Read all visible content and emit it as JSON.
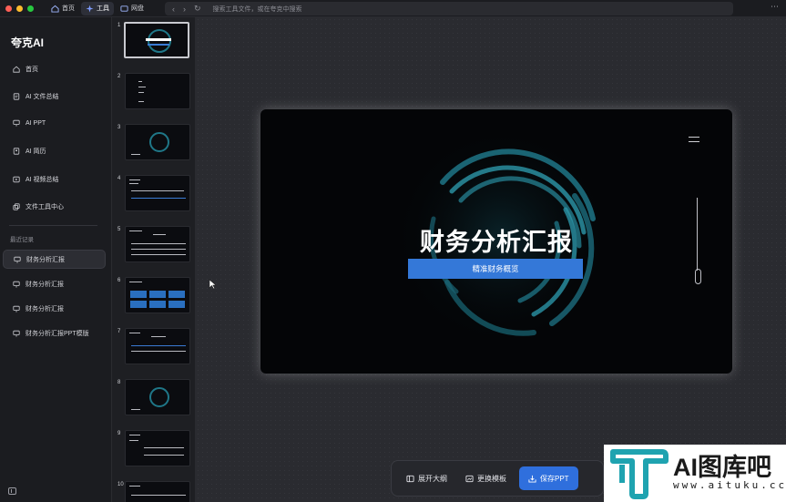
{
  "titlebar": {
    "tabs": [
      {
        "label": "首页",
        "icon": "home-icon"
      },
      {
        "label": "工具",
        "icon": "sparkle-icon",
        "active": true
      },
      {
        "label": "网盘",
        "icon": "cloud-drive-icon"
      }
    ],
    "address_placeholder": "搜索工具文件，或在夸克中搜索"
  },
  "sidebar": {
    "brand": "夸克AI",
    "items": [
      {
        "label": "首页",
        "icon": "home-icon"
      },
      {
        "label": "AI 文件总结",
        "icon": "file-summary-icon"
      },
      {
        "label": "AI PPT",
        "icon": "ppt-icon"
      },
      {
        "label": "AI 简历",
        "icon": "resume-icon"
      },
      {
        "label": "AI 视频总结",
        "icon": "video-summary-icon"
      },
      {
        "label": "文件工具中心",
        "icon": "file-tools-icon"
      }
    ],
    "recent_label": "最近记录",
    "recent": [
      {
        "label": "财务分析汇报",
        "active": true
      },
      {
        "label": "财务分析汇报"
      },
      {
        "label": "财务分析汇报"
      },
      {
        "label": "财务分析汇报PPT模版"
      }
    ]
  },
  "thumbnails": [
    "1",
    "2",
    "3",
    "4",
    "5",
    "6",
    "7",
    "8",
    "9",
    "10"
  ],
  "slide": {
    "title": "财务分析汇报",
    "subtitle": "精准财务概览"
  },
  "toolbar": {
    "expand_outline": "展开大纲",
    "change_template": "更换模板",
    "save_ppt": "保存PPT"
  },
  "watermark": {
    "text": "AI图库吧",
    "url": "www.aituku.cc"
  },
  "colors": {
    "accent": "#2f6fdd",
    "slide_bar": "#3478d8",
    "swirl": "#1f7788"
  }
}
